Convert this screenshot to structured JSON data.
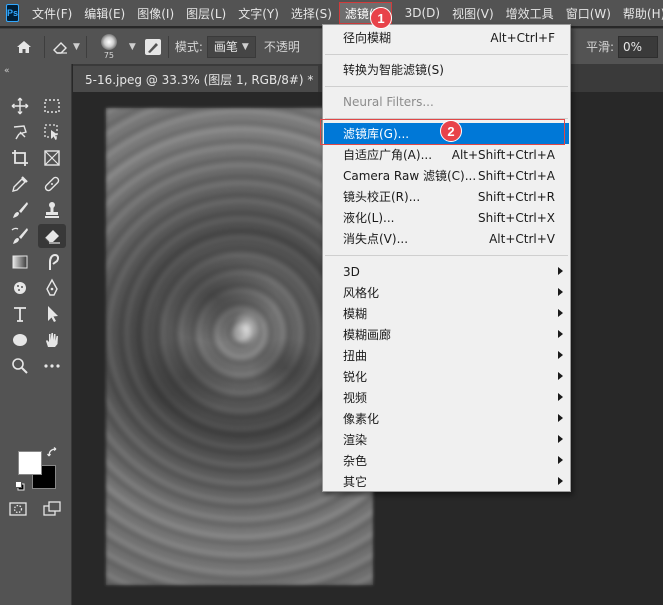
{
  "app": {
    "logo_text": "Ps"
  },
  "menubar": {
    "items": [
      {
        "label": "文件(F)"
      },
      {
        "label": "编辑(E)"
      },
      {
        "label": "图像(I)"
      },
      {
        "label": "图层(L)"
      },
      {
        "label": "文字(Y)"
      },
      {
        "label": "选择(S)"
      },
      {
        "label": "滤镜(T)",
        "active": true
      },
      {
        "label": "3D(D)"
      },
      {
        "label": "视图(V)"
      },
      {
        "label": "增效工具"
      },
      {
        "label": "窗口(W)"
      },
      {
        "label": "帮助(H)"
      }
    ]
  },
  "options": {
    "brush_size": "75",
    "mode_label": "模式:",
    "mode_value": "画笔",
    "opacity_label": "不透明",
    "smooth_label": "平滑:",
    "smooth_value": "0%"
  },
  "document": {
    "tab_title": "5-16.jpeg @ 33.3% (图层 1, RGB/8#) *",
    "close_glyph": "×"
  },
  "filter_menu": {
    "items": [
      {
        "label": "径向模糊",
        "shortcut": "Alt+Ctrl+F"
      },
      {
        "label": "转换为智能滤镜(S)",
        "shortcut": ""
      },
      {
        "label": "Neural Filters...",
        "shortcut": "",
        "disabled": true
      },
      {
        "label": "滤镜库(G)...",
        "shortcut": "",
        "highlighted": true
      },
      {
        "label": "自适应广角(A)...",
        "shortcut": "Alt+Shift+Ctrl+A"
      },
      {
        "label": "Camera Raw 滤镜(C)...",
        "shortcut": "Shift+Ctrl+A"
      },
      {
        "label": "镜头校正(R)...",
        "shortcut": "Shift+Ctrl+R"
      },
      {
        "label": "液化(L)...",
        "shortcut": "Shift+Ctrl+X"
      },
      {
        "label": "消失点(V)...",
        "shortcut": "Alt+Ctrl+V"
      },
      {
        "label": "3D",
        "submenu": true
      },
      {
        "label": "风格化",
        "submenu": true
      },
      {
        "label": "模糊",
        "submenu": true
      },
      {
        "label": "模糊画廊",
        "submenu": true
      },
      {
        "label": "扭曲",
        "submenu": true
      },
      {
        "label": "锐化",
        "submenu": true
      },
      {
        "label": "视频",
        "submenu": true
      },
      {
        "label": "像素化",
        "submenu": true
      },
      {
        "label": "渲染",
        "submenu": true
      },
      {
        "label": "杂色",
        "submenu": true
      },
      {
        "label": "其它",
        "submenu": true
      }
    ]
  },
  "annotations": {
    "step1": "1",
    "step2": "2"
  },
  "colors": {
    "highlight": "#0078d7",
    "annotation_red": "#e8434a",
    "fg": "#ffffff",
    "bg": "#000000"
  }
}
